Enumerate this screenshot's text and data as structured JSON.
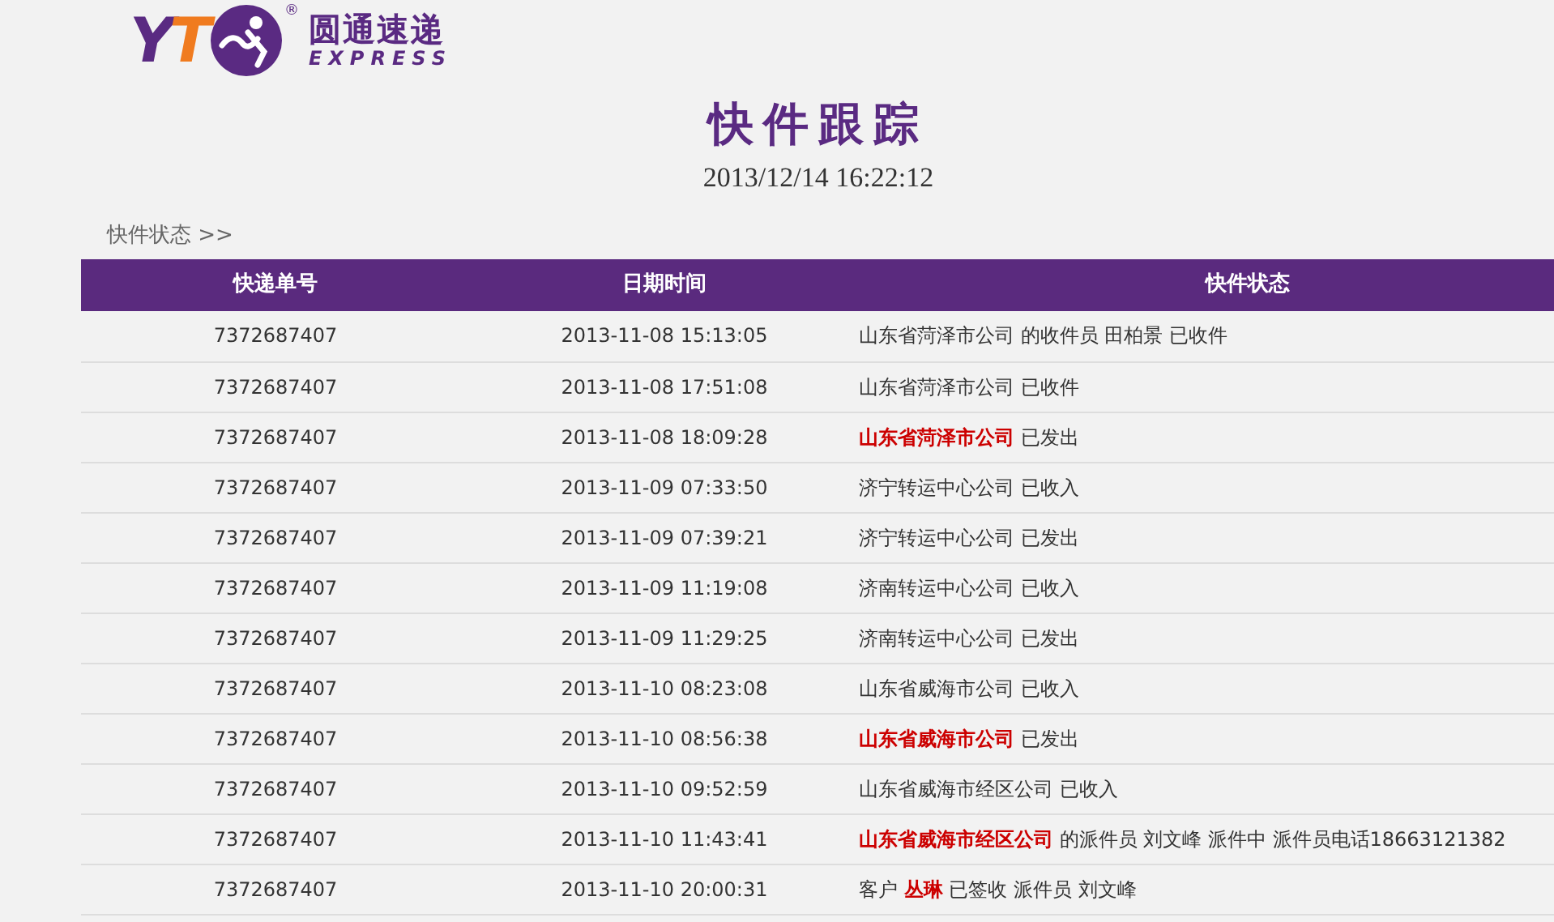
{
  "logo": {
    "letters": [
      {
        "text": "Y",
        "color": "#5a2a82"
      },
      {
        "text": "T",
        "color": "#f07b1f"
      }
    ],
    "registered": "®",
    "name": "圆通速递",
    "tagline": "EXPRESS"
  },
  "title": "快件跟踪",
  "timestamp": "2013/12/14 16:22:12",
  "breadcrumb": "快件状态 >>",
  "table": {
    "columns": [
      "快递单号",
      "日期时间",
      "快件状态"
    ],
    "rows": [
      {
        "number": "7372687407",
        "time": "2013-11-08 15:13:05",
        "status": "山东省菏泽市公司 的收件员 田柏景 已收件"
      },
      {
        "number": "7372687407",
        "time": "2013-11-08 17:51:08",
        "status": "山东省菏泽市公司 已收件"
      },
      {
        "number": "7372687407",
        "time": "2013-11-08 18:09:28",
        "status": "**山东省菏泽市公司** 已发出"
      },
      {
        "number": "7372687407",
        "time": "2013-11-09 07:33:50",
        "status": "济宁转运中心公司 已收入"
      },
      {
        "number": "7372687407",
        "time": "2013-11-09 07:39:21",
        "status": "济宁转运中心公司 已发出"
      },
      {
        "number": "7372687407",
        "time": "2013-11-09 11:19:08",
        "status": "济南转运中心公司 已收入"
      },
      {
        "number": "7372687407",
        "time": "2013-11-09 11:29:25",
        "status": "济南转运中心公司 已发出"
      },
      {
        "number": "7372687407",
        "time": "2013-11-10 08:23:08",
        "status": "山东省威海市公司 已收入"
      },
      {
        "number": "7372687407",
        "time": "2013-11-10 08:56:38",
        "status": "**山东省威海市公司** 已发出"
      },
      {
        "number": "7372687407",
        "time": "2013-11-10 09:52:59",
        "status": "山东省威海市经区公司 已收入"
      },
      {
        "number": "7372687407",
        "time": "2013-11-10 11:43:41",
        "status": "**山东省威海市经区公司** 的派件员 刘文峰 派件中 派件员电话18663121382"
      },
      {
        "number": "7372687407",
        "time": "2013-11-10 20:00:31",
        "status": "客户 **丛琳** 已签收 派件员 刘文峰"
      }
    ]
  }
}
